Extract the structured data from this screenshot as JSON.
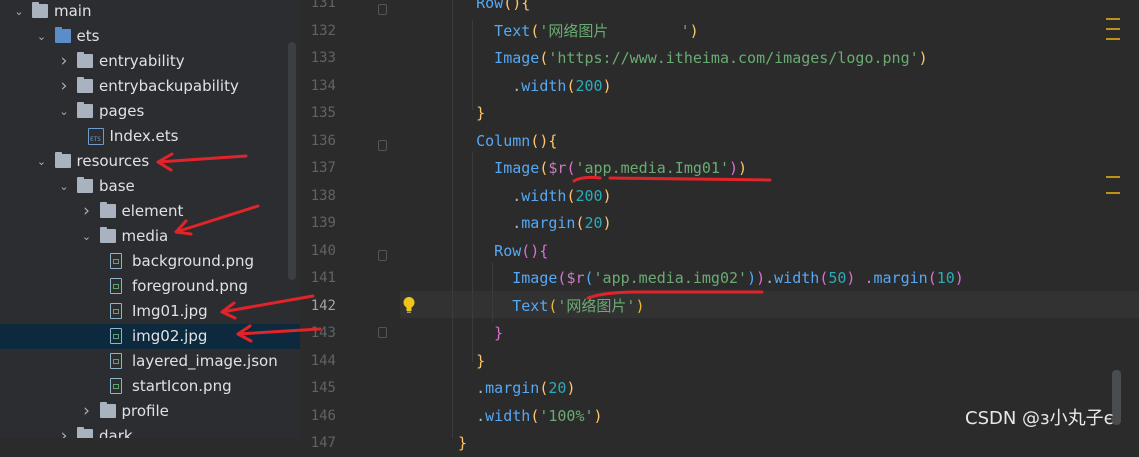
{
  "project_tree": [
    {
      "label": "main",
      "depth": 0,
      "expanded": true,
      "type": "folder",
      "icon": "folder-icon"
    },
    {
      "label": "ets",
      "depth": 1,
      "expanded": true,
      "type": "folder-blue",
      "icon": "source-folder-icon"
    },
    {
      "label": "entryability",
      "depth": 2,
      "expanded": false,
      "type": "folder",
      "icon": "folder-icon"
    },
    {
      "label": "entrybackupability",
      "depth": 2,
      "expanded": false,
      "type": "folder",
      "icon": "folder-icon"
    },
    {
      "label": "pages",
      "depth": 2,
      "expanded": true,
      "type": "folder",
      "icon": "folder-icon"
    },
    {
      "label": "Index.ets",
      "depth": 3,
      "type": "ets",
      "icon": "ets-file-icon"
    },
    {
      "label": "resources",
      "depth": 1,
      "expanded": true,
      "type": "folder",
      "icon": "folder-icon"
    },
    {
      "label": "base",
      "depth": 2,
      "expanded": true,
      "type": "folder",
      "icon": "folder-icon"
    },
    {
      "label": "element",
      "depth": 3,
      "expanded": false,
      "type": "folder",
      "icon": "folder-icon"
    },
    {
      "label": "media",
      "depth": 3,
      "expanded": true,
      "type": "folder",
      "icon": "folder-icon"
    },
    {
      "label": "background.png",
      "depth": 4,
      "type": "file",
      "icon": "image-file-icon"
    },
    {
      "label": "foreground.png",
      "depth": 4,
      "type": "file",
      "icon": "image-file-icon"
    },
    {
      "label": "Img01.jpg",
      "depth": 4,
      "type": "file",
      "icon": "image-file-icon"
    },
    {
      "label": "img02.jpg",
      "depth": 4,
      "type": "file",
      "icon": "image-file-icon",
      "selected": true
    },
    {
      "label": "layered_image.json",
      "depth": 4,
      "type": "file",
      "icon": "json-file-icon"
    },
    {
      "label": "startIcon.png",
      "depth": 4,
      "type": "file",
      "icon": "image-file-icon"
    },
    {
      "label": "profile",
      "depth": 3,
      "expanded": false,
      "type": "folder",
      "icon": "folder-icon"
    },
    {
      "label": "dark",
      "depth": 2,
      "expanded": false,
      "type": "folder",
      "icon": "folder-icon"
    }
  ],
  "editor": {
    "current_line": "142",
    "lines": [
      {
        "num": "131",
        "tokens": [
          [
            "    Row",
            "k-fn"
          ],
          [
            "(){",
            "k-par"
          ]
        ]
      },
      {
        "num": "132",
        "tokens": [
          [
            "      Text",
            "k-fn"
          ],
          [
            "(",
            "k-par"
          ],
          [
            "'网络图片        '",
            "k-str"
          ],
          [
            ")",
            "k-par"
          ]
        ]
      },
      {
        "num": "133",
        "tokens": [
          [
            "      Image",
            "k-fn"
          ],
          [
            "(",
            "k-par"
          ],
          [
            "'https://www.itheima.com/images/logo.png'",
            "k-str"
          ],
          [
            ")",
            "k-par"
          ]
        ]
      },
      {
        "num": "134",
        "tokens": [
          [
            "        .",
            "k-dot"
          ],
          [
            "width",
            "k-fn"
          ],
          [
            "(",
            "k-par"
          ],
          [
            "200",
            "k-num"
          ],
          [
            ")",
            "k-par"
          ]
        ]
      },
      {
        "num": "135",
        "tokens": [
          [
            "    }",
            "k-par"
          ]
        ]
      },
      {
        "num": "136",
        "tokens": [
          [
            "    Column",
            "k-fn"
          ],
          [
            "(){",
            "k-par"
          ]
        ]
      },
      {
        "num": "137",
        "tokens": [
          [
            "      Image",
            "k-fn"
          ],
          [
            "(",
            "k-par"
          ],
          [
            "$r",
            "k-res"
          ],
          [
            "(",
            "k-b2"
          ],
          [
            "'app.media.Img01'",
            "k-str"
          ],
          [
            ")",
            "k-b2"
          ],
          [
            ")",
            "k-par"
          ]
        ]
      },
      {
        "num": "138",
        "tokens": [
          [
            "        .",
            "k-dot"
          ],
          [
            "width",
            "k-fn"
          ],
          [
            "(",
            "k-par"
          ],
          [
            "200",
            "k-num"
          ],
          [
            ")",
            "k-par"
          ]
        ]
      },
      {
        "num": "139",
        "tokens": [
          [
            "        .",
            "k-dot"
          ],
          [
            "margin",
            "k-fn"
          ],
          [
            "(",
            "k-par"
          ],
          [
            "20",
            "k-num"
          ],
          [
            ")",
            "k-par"
          ]
        ]
      },
      {
        "num": "140",
        "tokens": [
          [
            "      Row",
            "k-fn"
          ],
          [
            "(){",
            "k-b2"
          ]
        ]
      },
      {
        "num": "141",
        "tokens": [
          [
            "        Image",
            "k-fn"
          ],
          [
            "(",
            "k-b2"
          ],
          [
            "$r",
            "k-res"
          ],
          [
            "(",
            "k-fn"
          ],
          [
            "'app.media.img02'",
            "k-str"
          ],
          [
            ")",
            "k-fn"
          ],
          [
            ")",
            "k-b2"
          ],
          [
            ".",
            "k-dot"
          ],
          [
            "width",
            "k-fn"
          ],
          [
            "(",
            "k-b2"
          ],
          [
            "50",
            "k-num"
          ],
          [
            ") .",
            "k-b2"
          ],
          [
            "margin",
            "k-fn"
          ],
          [
            "(",
            "k-b2"
          ],
          [
            "10",
            "k-num"
          ],
          [
            ")",
            "k-b2"
          ]
        ]
      },
      {
        "num": "142",
        "tokens": [
          [
            "        Text",
            "k-fn"
          ],
          [
            "(",
            "k-brace"
          ],
          [
            "'网络图片'",
            "k-str"
          ],
          [
            ")",
            "k-brace"
          ]
        ]
      },
      {
        "num": "143",
        "tokens": [
          [
            "      }",
            "k-b2"
          ]
        ]
      },
      {
        "num": "144",
        "tokens": [
          [
            "    }",
            "k-par"
          ]
        ]
      },
      {
        "num": "145",
        "tokens": [
          [
            "    .",
            "k-dot"
          ],
          [
            "margin",
            "k-fn"
          ],
          [
            "(",
            "k-par"
          ],
          [
            "20",
            "k-num"
          ],
          [
            ")",
            "k-par"
          ]
        ]
      },
      {
        "num": "146",
        "tokens": [
          [
            "    .",
            "k-dot"
          ],
          [
            "width",
            "k-fn"
          ],
          [
            "(",
            "k-par"
          ],
          [
            "'100%'",
            "k-str"
          ],
          [
            ")",
            "k-par"
          ]
        ]
      },
      {
        "num": "147",
        "tokens": [
          [
            "  }",
            "k-par"
          ]
        ]
      }
    ]
  },
  "icons": {
    "intention_bulb": "lightbulb-icon",
    "expand": "chevron-down-icon",
    "collapse": "chevron-right-icon"
  },
  "colors": {
    "annotation_red": "#e0242a",
    "accent_yellow": "#be9117",
    "selection": "#0d293e"
  },
  "watermark": "CSDN @з小丸子є"
}
